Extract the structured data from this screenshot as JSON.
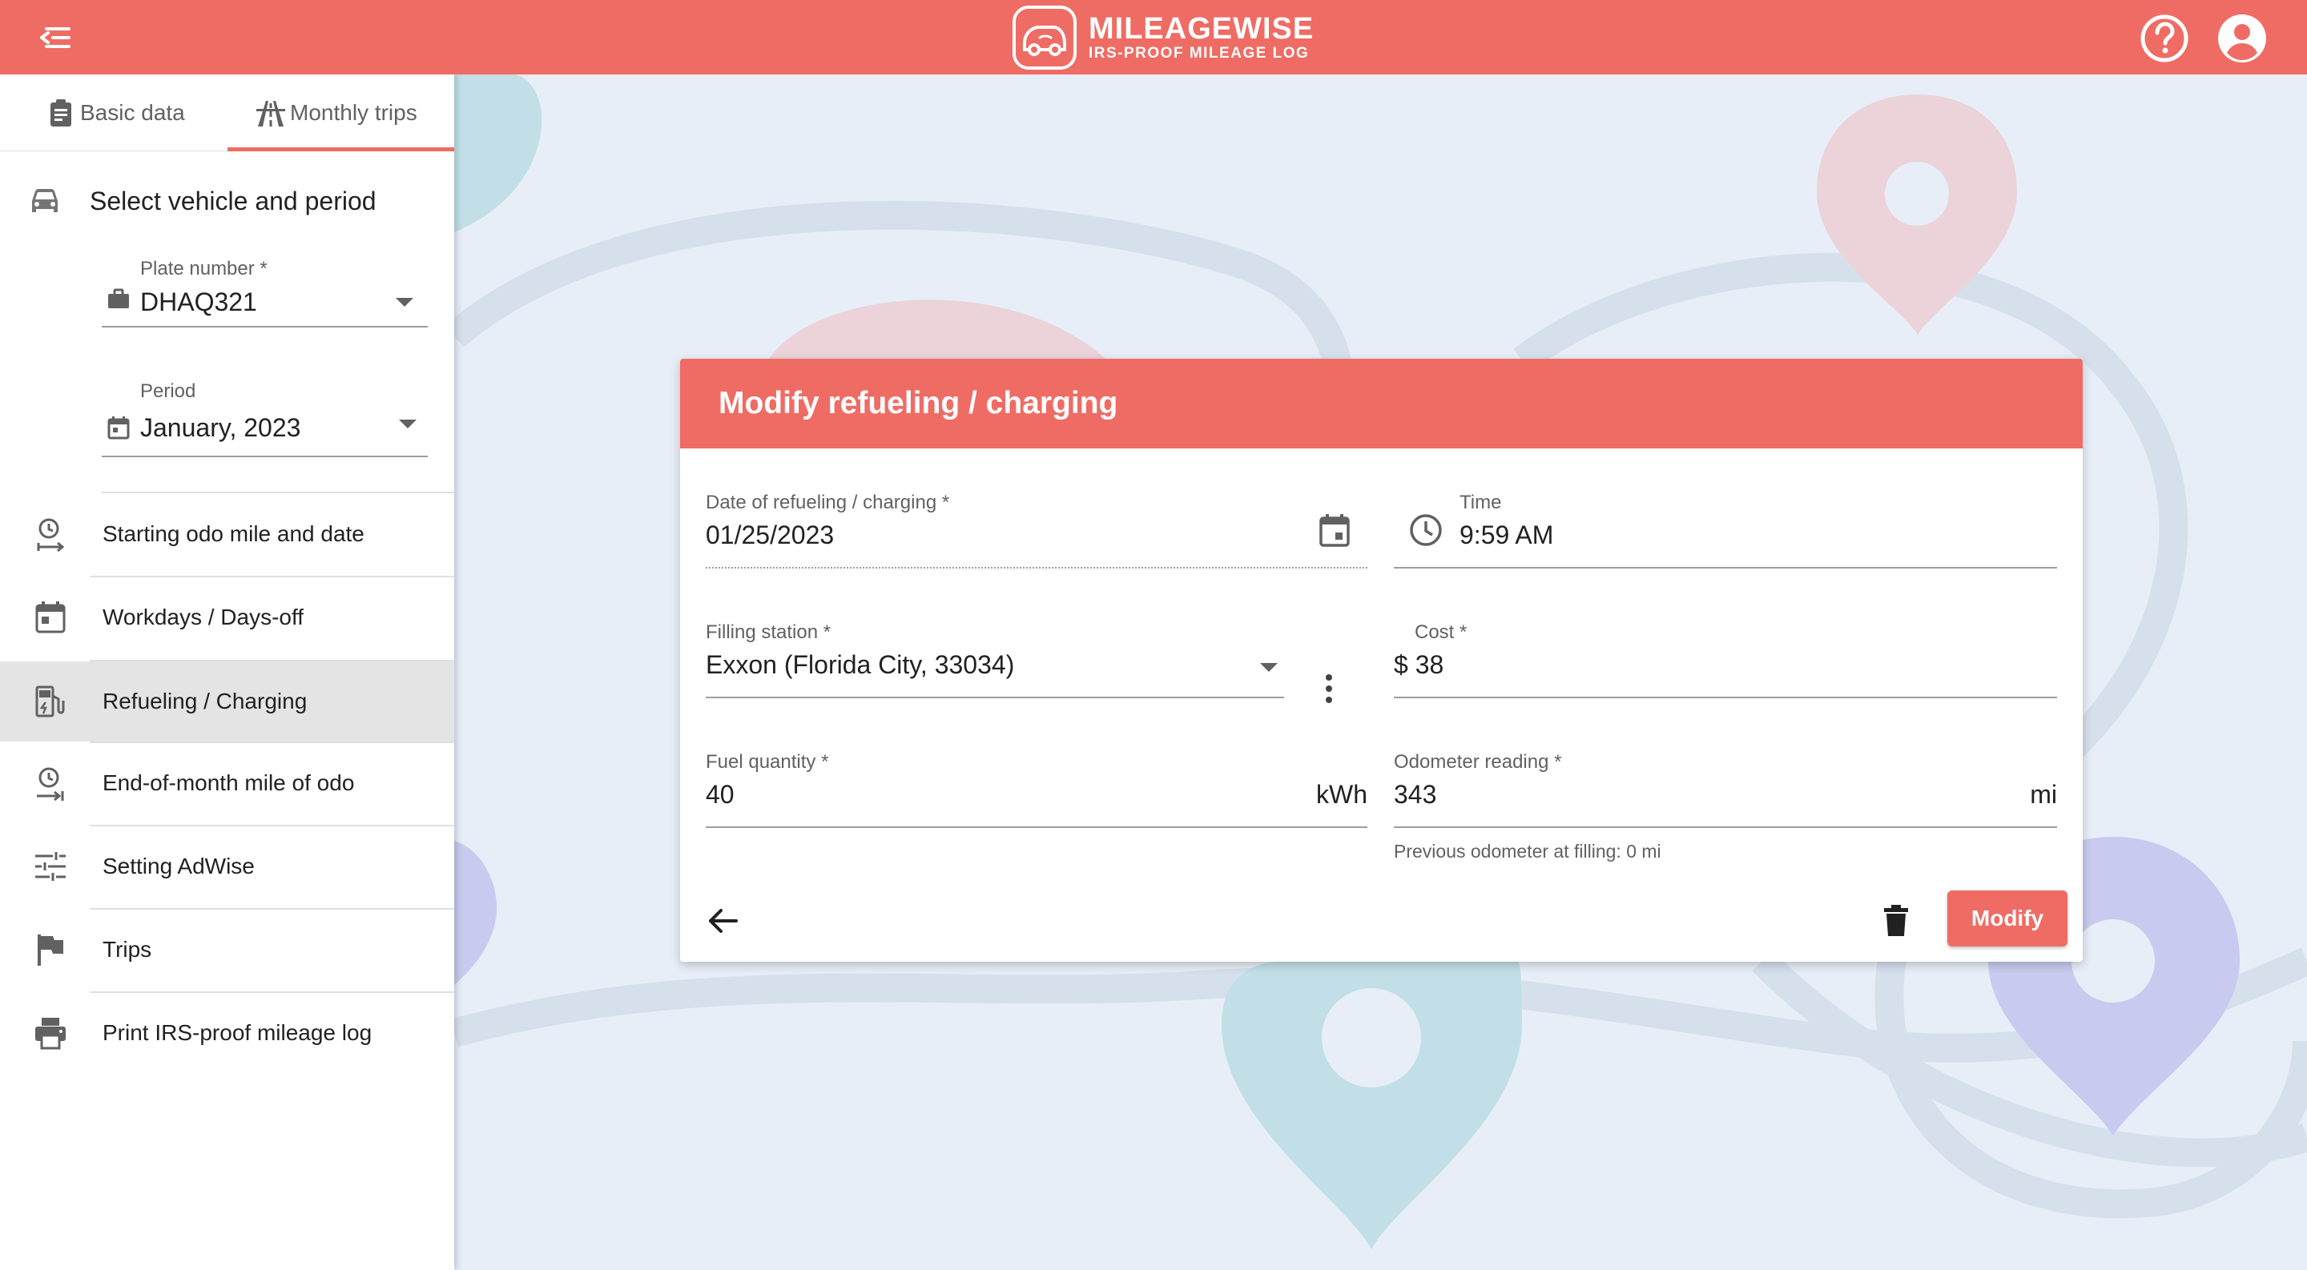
{
  "app": {
    "brand_name": "MILEAGEWISE",
    "brand_tagline": "IRS-PROOF MILEAGE LOG",
    "brand_color": "#ef6c64"
  },
  "icons": {
    "menu": "menu-open-icon",
    "help": "help-circle-icon",
    "account": "account-circle-icon"
  },
  "sidebar": {
    "tabs": [
      {
        "label": "Basic data",
        "icon": "clipboard-icon",
        "active": false
      },
      {
        "label": "Monthly trips",
        "icon": "road-icon",
        "active": true
      }
    ],
    "section_title": "Select vehicle and period",
    "plate": {
      "label": "Plate number *",
      "value": "DHAQ321"
    },
    "period": {
      "label": "Period",
      "value": "January, 2023"
    },
    "items": [
      {
        "label": "Starting odo mile and date",
        "icon": "clock-arrow-icon"
      },
      {
        "label": "Workdays / Days-off",
        "icon": "calendar-icon"
      },
      {
        "label": "Refueling / Charging",
        "icon": "fuel-ev-icon",
        "active": true
      },
      {
        "label": "End-of-month mile of odo",
        "icon": "clock-end-icon"
      },
      {
        "label": "Setting AdWise",
        "icon": "tune-icon"
      },
      {
        "label": "Trips",
        "icon": "flag-icon"
      },
      {
        "label": "Print IRS-proof mileage log",
        "icon": "printer-icon"
      }
    ]
  },
  "dialog": {
    "title": "Modify refueling / charging",
    "date": {
      "label": "Date of refueling / charging *",
      "value": "01/25/2023"
    },
    "time": {
      "label": "Time",
      "value": "9:59 AM"
    },
    "station": {
      "label": "Filling station *",
      "value": "Exxon (Florida City, 33034)"
    },
    "cost": {
      "label": "Cost *",
      "value": "$ 38"
    },
    "fuel": {
      "label": "Fuel quantity *",
      "value": "40",
      "unit": "kWh"
    },
    "odometer": {
      "label": "Odometer reading *",
      "value": "343",
      "unit": "mi"
    },
    "odometer_hint": "Previous odometer at filling: 0 mi",
    "modify_label": "Modify"
  }
}
